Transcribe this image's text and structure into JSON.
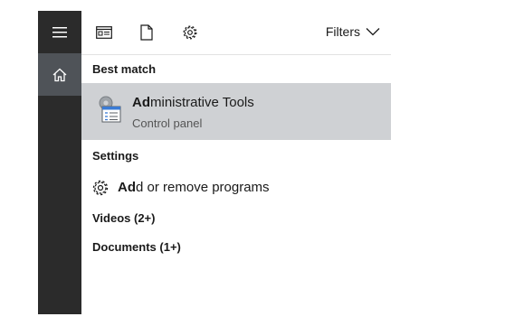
{
  "rail": {
    "menu_icon": "hamburger-icon",
    "home_icon": "home-icon",
    "colors": {
      "background": "#2b2b2b",
      "selected": "#4f5358"
    }
  },
  "toolbar": {
    "icons": [
      "apps-icon",
      "document-icon",
      "gear-icon"
    ],
    "filters_label": "Filters"
  },
  "results": {
    "best_match_header": "Best match",
    "best_match": {
      "title_bold": "Ad",
      "title_rest": "ministrative Tools",
      "subtitle": "Control panel",
      "icon": "admin-tools-icon",
      "highlight_color": "#cfd1d4"
    },
    "settings_header": "Settings",
    "settings_item": {
      "label_bold": "Ad",
      "label_rest": "d or remove programs",
      "icon": "gear-icon"
    },
    "videos_header": "Videos (2+)",
    "documents_header": "Documents (1+)"
  }
}
